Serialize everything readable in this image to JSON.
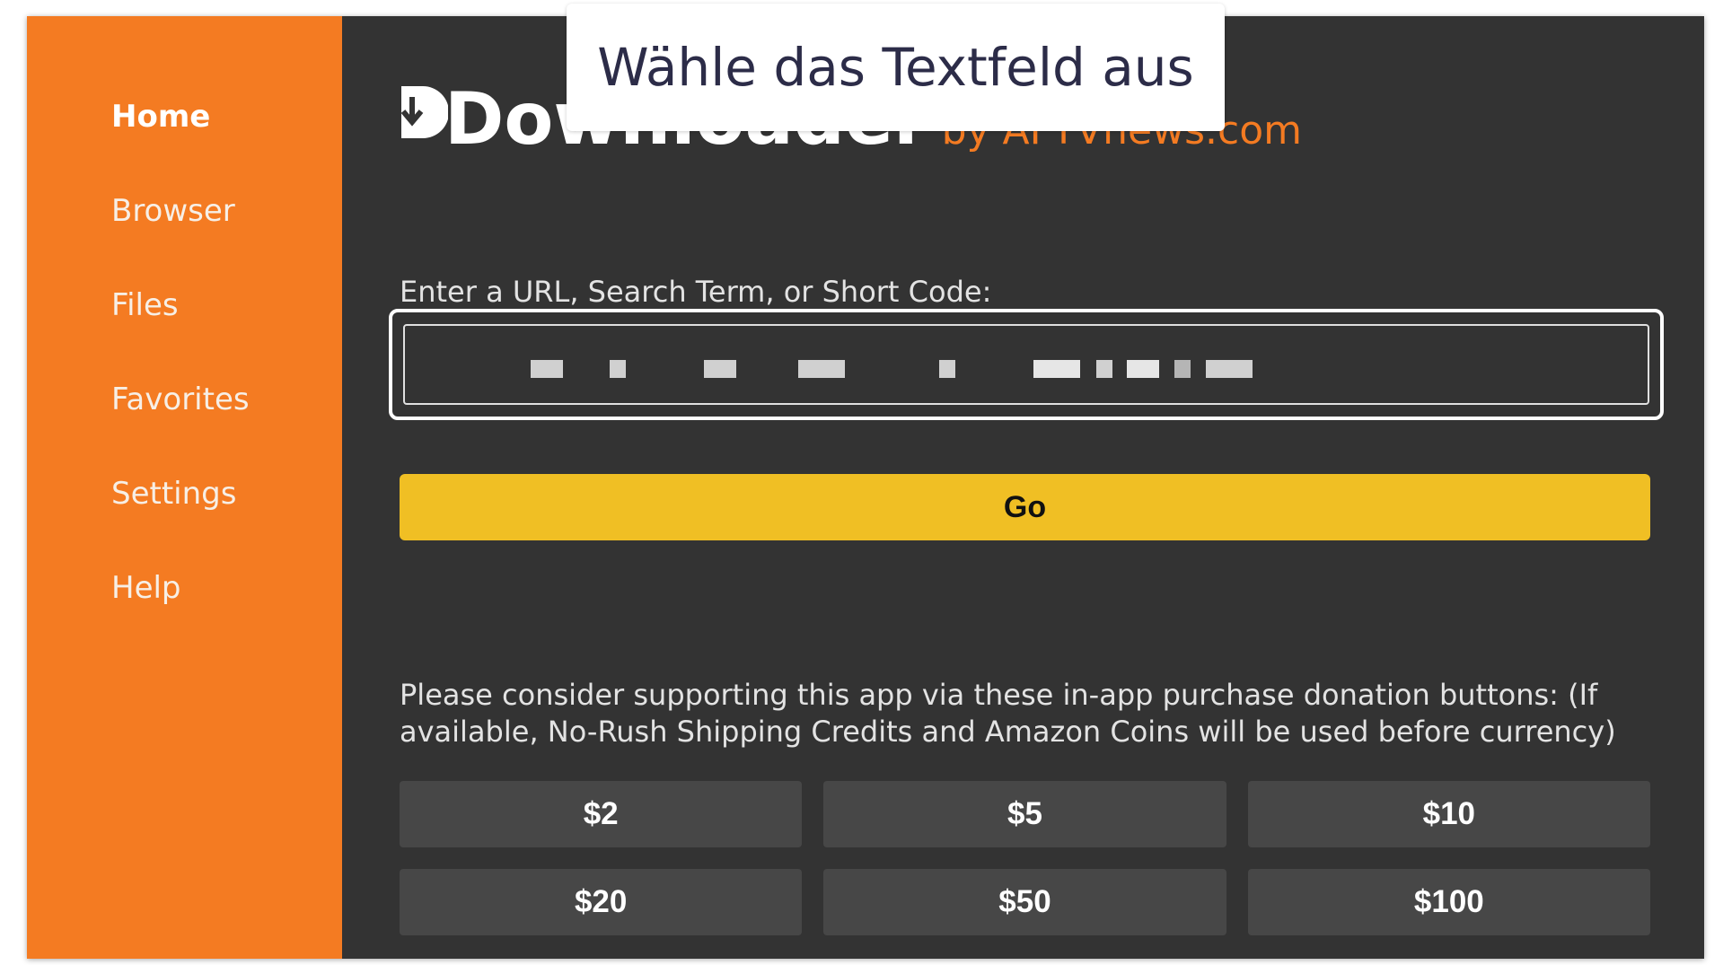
{
  "sidebar": {
    "items": [
      {
        "label": "Home",
        "active": true
      },
      {
        "label": "Browser",
        "active": false
      },
      {
        "label": "Files",
        "active": false
      },
      {
        "label": "Favorites",
        "active": false
      },
      {
        "label": "Settings",
        "active": false
      },
      {
        "label": "Help",
        "active": false
      }
    ]
  },
  "header": {
    "logo_text": "Downloader",
    "logo_byline": "by AFTVnews.com"
  },
  "url_section": {
    "label": "Enter a URL, Search Term, or Short Code:",
    "value_redacted": true
  },
  "go_button": {
    "label": "Go"
  },
  "donation": {
    "text": "Please consider supporting this app via these in-app purchase donation buttons: (If available, No-Rush Shipping Credits and Amazon Coins will be used before currency)",
    "buttons": [
      "$2",
      "$5",
      "$10",
      "$20",
      "$50",
      "$100"
    ]
  },
  "callout": {
    "text": "Wähle das Textfeld aus"
  },
  "colors": {
    "sidebar": "#f47b22",
    "main_bg": "#333333",
    "go_button": "#f0bf24",
    "donate_button": "#474747"
  },
  "icons": {
    "logo_icon": "download-arrow-icon"
  }
}
